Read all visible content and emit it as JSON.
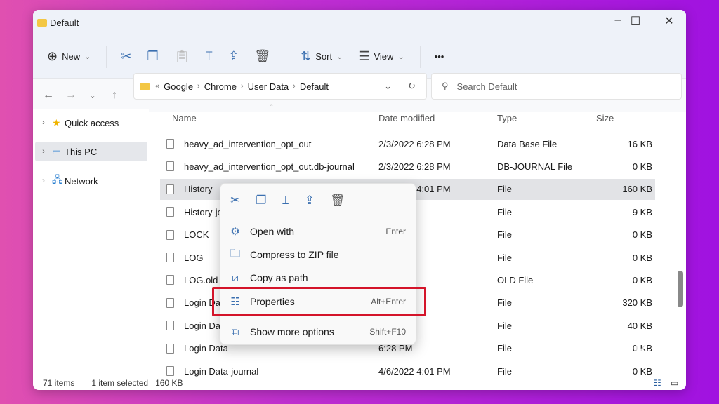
{
  "window": {
    "title": "Default"
  },
  "toolbar": {
    "new": "New",
    "sort": "Sort",
    "view": "View",
    "more": "•••"
  },
  "address": {
    "crumbs": [
      "Google",
      "Chrome",
      "User Data",
      "Default"
    ],
    "search_placeholder": "Search Default"
  },
  "sidebar": {
    "items": [
      {
        "label": "Quick access"
      },
      {
        "label": "This PC"
      },
      {
        "label": "Network"
      }
    ]
  },
  "columns": {
    "name": "Name",
    "date": "Date modified",
    "type": "Type",
    "size": "Size"
  },
  "files": [
    {
      "name": "heavy_ad_intervention_opt_out",
      "date": "2/3/2022 6:28 PM",
      "type": "Data Base File",
      "size": "16 KB"
    },
    {
      "name": "heavy_ad_intervention_opt_out.db-journal",
      "date": "2/3/2022 6:28 PM",
      "type": "DB-JOURNAL File",
      "size": "0 KB"
    },
    {
      "name": "History",
      "date": "4/6/2022 4:01 PM",
      "type": "File",
      "size": "160 KB"
    },
    {
      "name": "History-jou",
      "date": "4:02 PM",
      "type": "File",
      "size": "9 KB"
    },
    {
      "name": "LOCK",
      "date": "6:28 PM",
      "type": "File",
      "size": "0 KB"
    },
    {
      "name": "LOG",
      "date": "4:01 PM",
      "type": "File",
      "size": "0 KB"
    },
    {
      "name": "LOG.old",
      "date": "6:34 PM",
      "type": "OLD File",
      "size": "0 KB"
    },
    {
      "name": "Login Data",
      "date": "4:01 PM",
      "type": "File",
      "size": "320 KB"
    },
    {
      "name": "Login Data",
      "date": "6:28 PM",
      "type": "File",
      "size": "40 KB"
    },
    {
      "name": "Login Data",
      "date": "6:28 PM",
      "type": "File",
      "size": "0 KB"
    },
    {
      "name": "Login Data-journal",
      "date": "4/6/2022 4:01 PM",
      "type": "File",
      "size": "0 KB"
    }
  ],
  "status": {
    "count": "71 items",
    "selected": "1 item selected",
    "size": "160 KB"
  },
  "context_menu": {
    "items": [
      {
        "label": "Open with",
        "shortcut": "Enter",
        "icon": "open-with-icon"
      },
      {
        "label": "Compress to ZIP file",
        "shortcut": "",
        "icon": "zip-icon"
      },
      {
        "label": "Copy as path",
        "shortcut": "",
        "icon": "copy-path-icon"
      },
      {
        "label": "Properties",
        "shortcut": "Alt+Enter",
        "icon": "properties-icon"
      },
      {
        "label": "Show more options",
        "shortcut": "Shift+F10",
        "icon": "more-options-icon"
      }
    ]
  },
  "colors": {
    "highlight": "#d4142a",
    "accent": "#3a6fb0"
  }
}
